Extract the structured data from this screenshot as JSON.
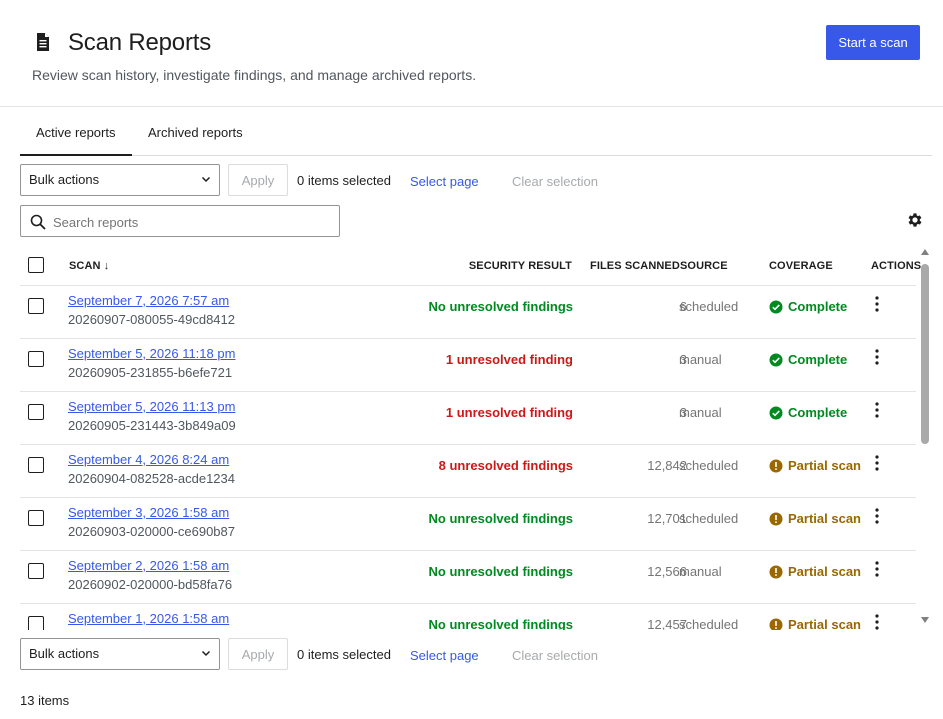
{
  "header": {
    "title": "Scan Reports",
    "subtitle": "Review scan history, investigate findings, and manage archived reports.",
    "start_button": "Start a scan",
    "icon": "document-icon"
  },
  "tabs": [
    {
      "label": "Active reports",
      "active": true
    },
    {
      "label": "Archived reports",
      "active": false
    }
  ],
  "bulk": {
    "select_value": "Bulk actions",
    "apply": "Apply",
    "selected": "0 items selected",
    "select_page": "Select page",
    "clear_selection": "Clear selection"
  },
  "search": {
    "placeholder": "Search reports"
  },
  "columns": {
    "scan": "Scan ↓",
    "security_result": "Security result",
    "files_scanned": "Files scanned",
    "source": "Source",
    "coverage": "Coverage",
    "actions": "Actions"
  },
  "colors": {
    "accent": "#3858e9",
    "ok": "#008a20",
    "error": "#cc1818",
    "warning": "#996800"
  },
  "rows": [
    {
      "date": "September 7, 2026 7:57 am",
      "id": "20260907-080055-49cd8412",
      "result": "No unresolved findings",
      "result_status": "ok",
      "files": "6",
      "source": "scheduled",
      "coverage": "Complete",
      "coverage_status": "ok"
    },
    {
      "date": "September 5, 2026 11:18 pm",
      "id": "20260905-231855-b6efe721",
      "result": "1 unresolved finding",
      "result_status": "error",
      "files": "3",
      "source": "manual",
      "coverage": "Complete",
      "coverage_status": "ok"
    },
    {
      "date": "September 5, 2026 11:13 pm",
      "id": "20260905-231443-3b849a09",
      "result": "1 unresolved finding",
      "result_status": "error",
      "files": "3",
      "source": "manual",
      "coverage": "Complete",
      "coverage_status": "ok"
    },
    {
      "date": "September 4, 2026 8:24 am",
      "id": "20260904-082528-acde1234",
      "result": "8 unresolved findings",
      "result_status": "error",
      "files": "12,842",
      "source": "scheduled",
      "coverage": "Partial scan",
      "coverage_status": "warning"
    },
    {
      "date": "September 3, 2026 1:58 am",
      "id": "20260903-020000-ce690b87",
      "result": "No unresolved findings",
      "result_status": "ok",
      "files": "12,701",
      "source": "scheduled",
      "coverage": "Partial scan",
      "coverage_status": "warning"
    },
    {
      "date": "September 2, 2026 1:58 am",
      "id": "20260902-020000-bd58fa76",
      "result": "No unresolved findings",
      "result_status": "ok",
      "files": "12,566",
      "source": "manual",
      "coverage": "Partial scan",
      "coverage_status": "warning"
    },
    {
      "date": "September 1, 2026 1:58 am",
      "id": "",
      "result": "No unresolved findings",
      "result_status": "ok",
      "files": "12,457",
      "source": "scheduled",
      "coverage": "Partial scan",
      "coverage_status": "warning"
    }
  ],
  "footer": {
    "count": "13 items"
  }
}
